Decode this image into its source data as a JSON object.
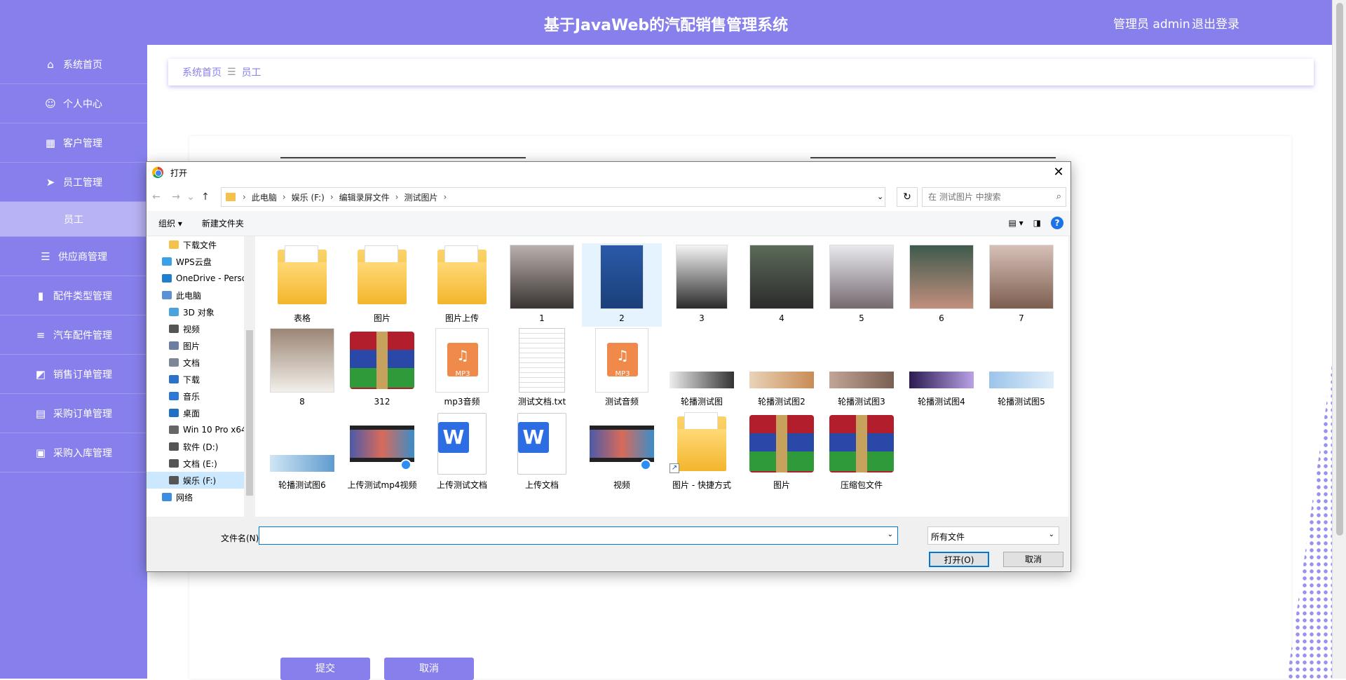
{
  "header": {
    "title": "基于JavaWeb的汽配销售管理系统",
    "user": "管理员 admin",
    "logout": "退出登录"
  },
  "sidebar": {
    "items": [
      {
        "label": "系统首页",
        "icon": "home-icon"
      },
      {
        "label": "个人中心",
        "icon": "user-icon"
      },
      {
        "label": "客户管理",
        "icon": "grid-icon"
      },
      {
        "label": "员工管理",
        "icon": "send-icon"
      },
      {
        "label": "员工",
        "icon": ""
      },
      {
        "label": "供应商管理",
        "icon": "sliders-icon"
      },
      {
        "label": "配件类型管理",
        "icon": "bar-chart-icon"
      },
      {
        "label": "汽车配件管理",
        "icon": "list-icon"
      },
      {
        "label": "销售订单管理",
        "icon": "line-chart-icon"
      },
      {
        "label": "采购订单管理",
        "icon": "table-icon"
      },
      {
        "label": "采购入库管理",
        "icon": "clipboard-icon"
      }
    ]
  },
  "breadcrumb": {
    "home": "系统首页",
    "sep": "☰",
    "current": "员工"
  },
  "form": {
    "submit": "提交",
    "cancel": "取消"
  },
  "dialog": {
    "title": "打开",
    "path": [
      "此电脑",
      "娱乐 (F:)",
      "编辑录屏文件",
      "测试图片"
    ],
    "search_placeholder": "在 测试图片 中搜索",
    "toolbar": {
      "organize": "组织 ▾",
      "new_folder": "新建文件夹"
    },
    "tree": [
      {
        "label": "下载文件",
        "lvl": 1
      },
      {
        "label": "WPS云盘",
        "lvl": 0
      },
      {
        "label": "OneDrive - Perso",
        "lvl": 0
      },
      {
        "label": "此电脑",
        "lvl": 0
      },
      {
        "label": "3D 对象",
        "lvl": 1
      },
      {
        "label": "视频",
        "lvl": 1
      },
      {
        "label": "图片",
        "lvl": 1
      },
      {
        "label": "文档",
        "lvl": 1
      },
      {
        "label": "下载",
        "lvl": 1
      },
      {
        "label": "音乐",
        "lvl": 1
      },
      {
        "label": "桌面",
        "lvl": 1
      },
      {
        "label": "Win 10 Pro x64",
        "lvl": 1
      },
      {
        "label": "软件 (D:)",
        "lvl": 1
      },
      {
        "label": "文档 (E:)",
        "lvl": 1
      },
      {
        "label": "娱乐 (F:)",
        "lvl": 1
      },
      {
        "label": "网络",
        "lvl": 0
      }
    ],
    "files": [
      {
        "name": "表格",
        "kind": "folder"
      },
      {
        "name": "图片",
        "kind": "folder"
      },
      {
        "name": "图片上传",
        "kind": "folder"
      },
      {
        "name": "1",
        "kind": "photo",
        "cls": "ph1"
      },
      {
        "name": "2",
        "kind": "photo",
        "cls": "ph2",
        "hl": true
      },
      {
        "name": "3",
        "kind": "photo",
        "cls": "ph3"
      },
      {
        "name": "4",
        "kind": "photo",
        "cls": "ph4"
      },
      {
        "name": "5",
        "kind": "photo",
        "cls": "ph5"
      },
      {
        "name": "6",
        "kind": "photo",
        "cls": "ph6"
      },
      {
        "name": "7",
        "kind": "photo",
        "cls": "ph7"
      },
      {
        "name": "8",
        "kind": "photo",
        "cls": "ph8"
      },
      {
        "name": "312",
        "kind": "winrar"
      },
      {
        "name": "mp3音频",
        "kind": "mp3"
      },
      {
        "name": "测试文档.txt",
        "kind": "txt"
      },
      {
        "name": "测试音频",
        "kind": "mp3"
      },
      {
        "name": "轮播测试图",
        "kind": "wide",
        "cls": "w1"
      },
      {
        "name": "轮播测试图2",
        "kind": "wide",
        "cls": "w2"
      },
      {
        "name": "轮播测试图3",
        "kind": "wide",
        "cls": "w3"
      },
      {
        "name": "轮播测试图4",
        "kind": "wide",
        "cls": "w4"
      },
      {
        "name": "轮播测试图5",
        "kind": "wide",
        "cls": "w5"
      },
      {
        "name": "轮播测试图6",
        "kind": "wide",
        "cls": "w6"
      },
      {
        "name": "上传测试mp4视频",
        "kind": "video"
      },
      {
        "name": "上传测试文档",
        "kind": "wdoc"
      },
      {
        "name": "上传文档",
        "kind": "wdoc"
      },
      {
        "name": "视频",
        "kind": "video"
      },
      {
        "name": "图片 - 快捷方式",
        "kind": "shortcut"
      },
      {
        "name": "图片",
        "kind": "winrar"
      },
      {
        "name": "压缩包文件",
        "kind": "winrar"
      }
    ],
    "filename_label": "文件名(N):",
    "filename_value": "",
    "filetype": "所有文件",
    "open": "打开(O)",
    "cancel": "取消"
  }
}
